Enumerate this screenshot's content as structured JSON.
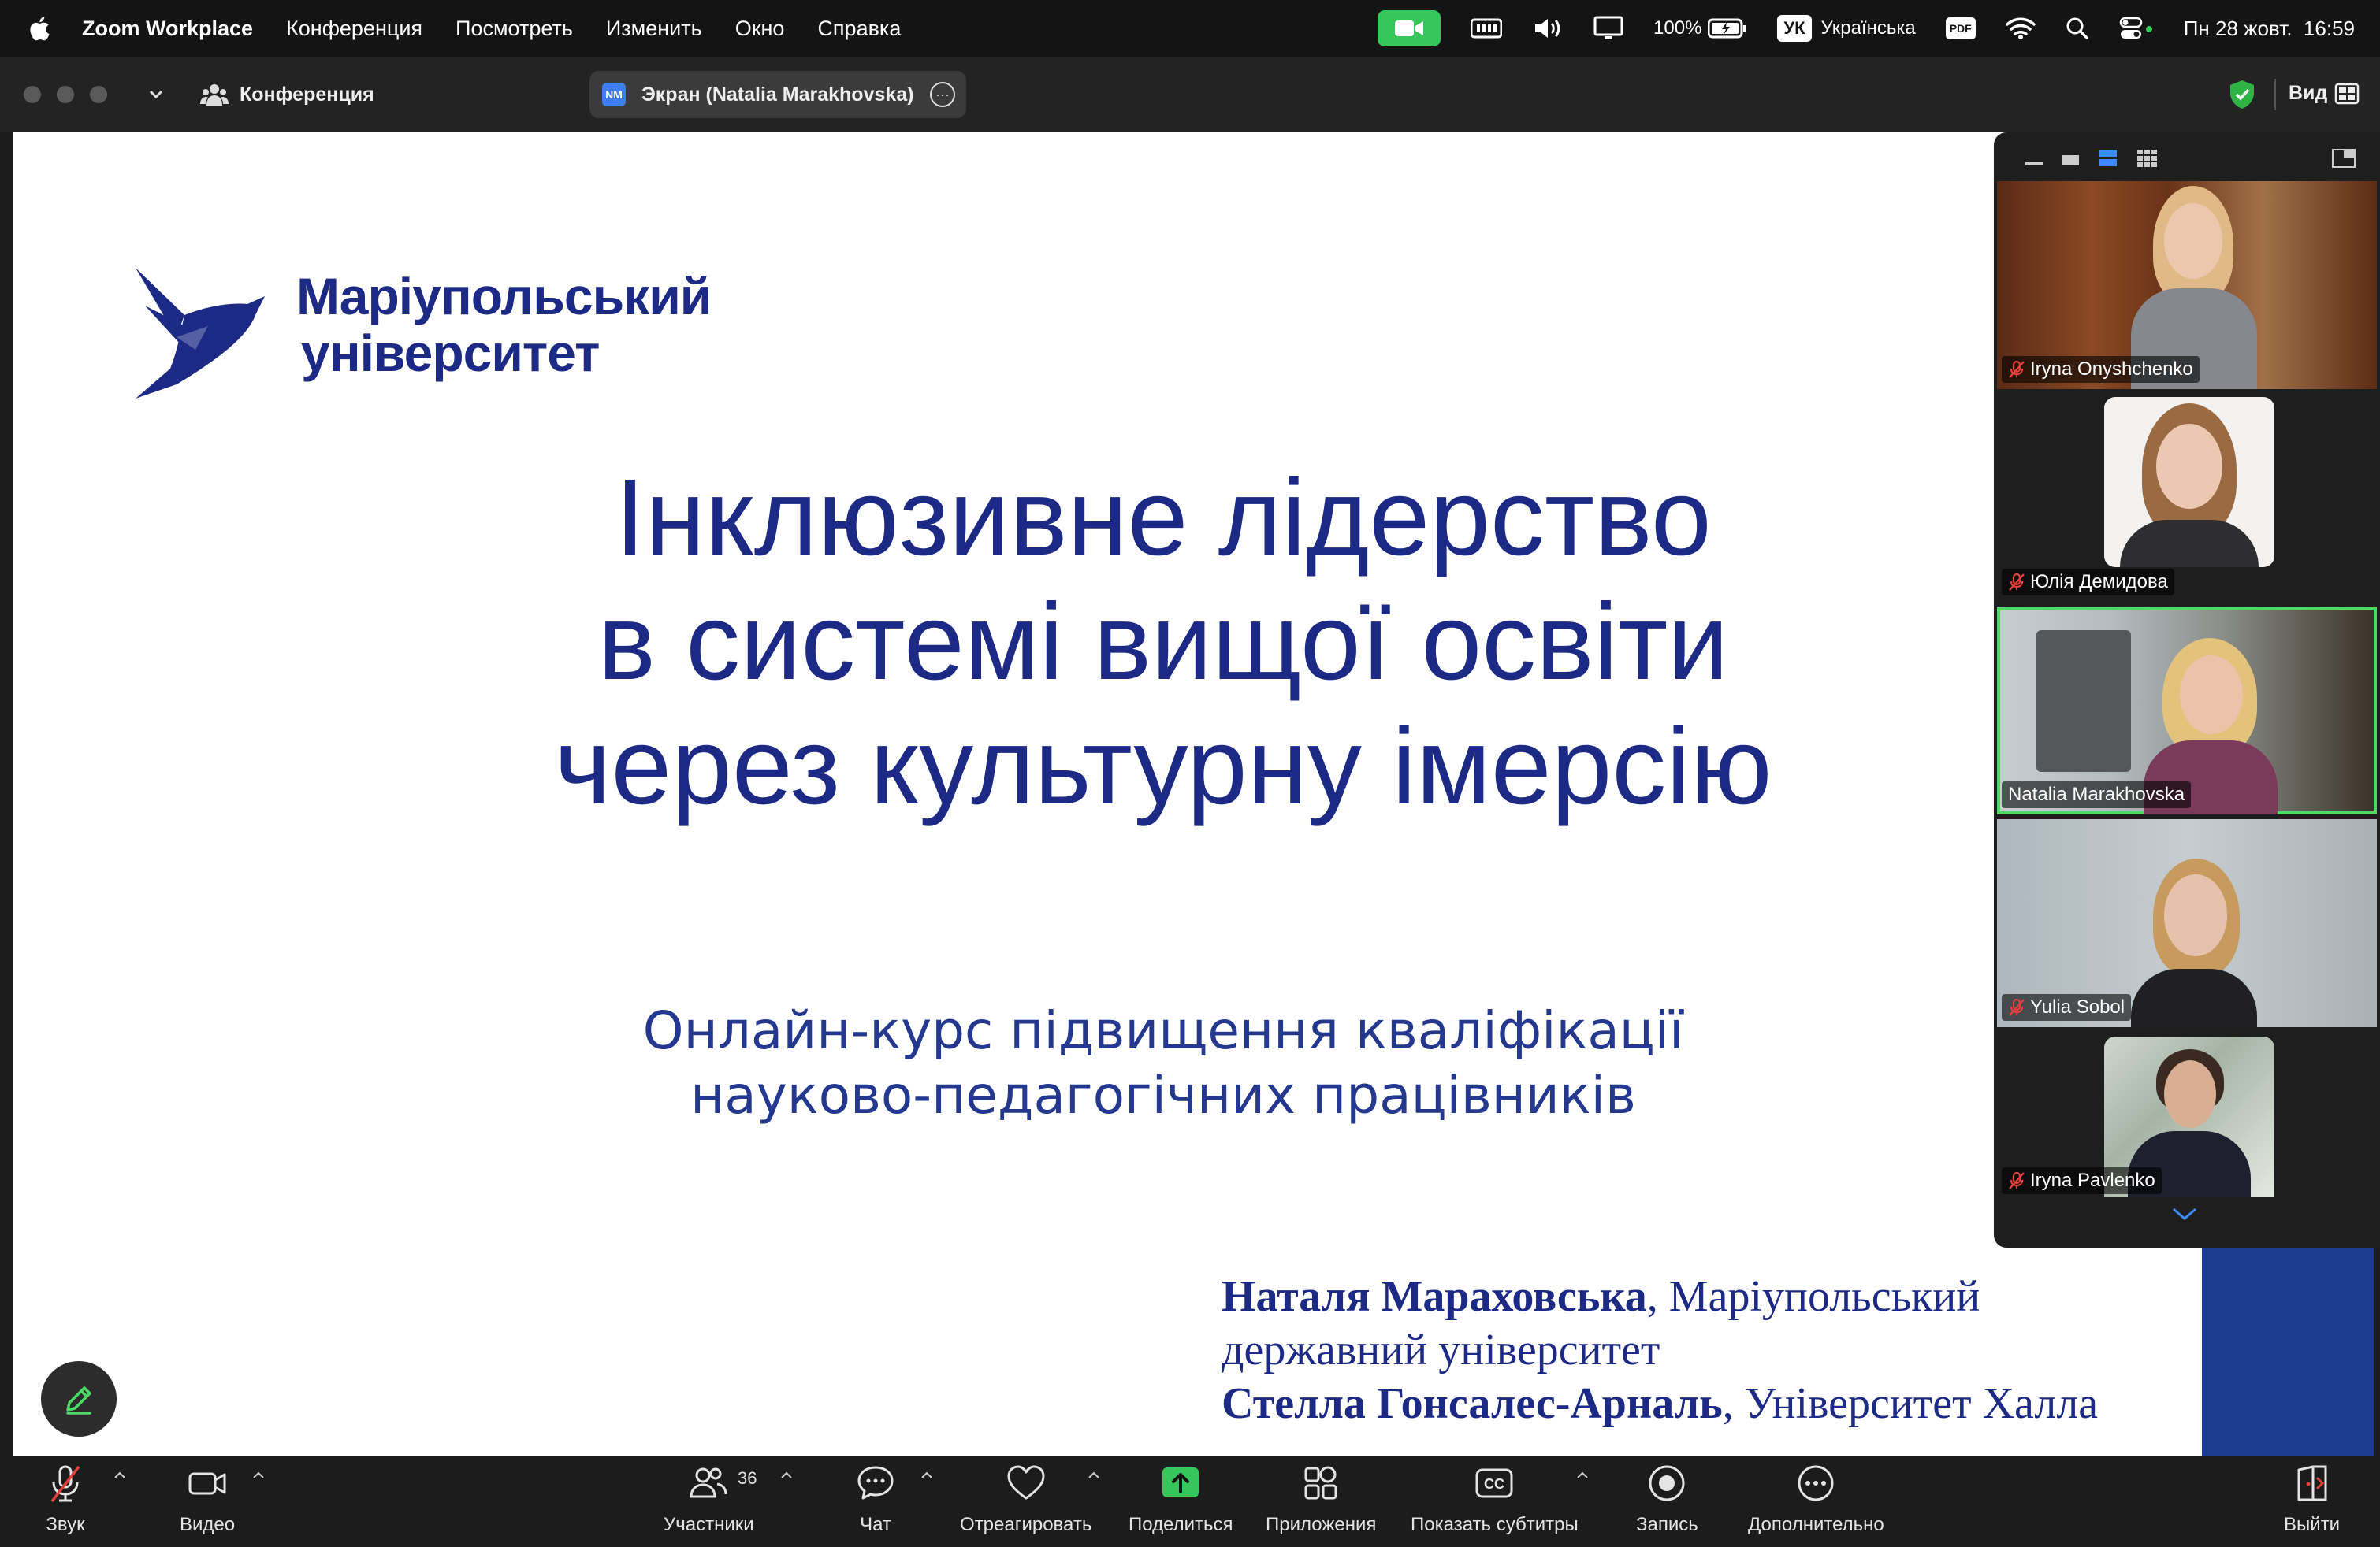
{
  "menubar": {
    "app_name": "Zoom Workplace",
    "items": [
      "Конференция",
      "Посмотреть",
      "Изменить",
      "Окно",
      "Справка"
    ],
    "battery": "100%",
    "input_lang_badge": "УК",
    "input_lang": "Українська",
    "pdf_badge": "PDF",
    "datetime": "Пн 28 жовт.  16:59"
  },
  "titlebar": {
    "conference_label": "Конференция",
    "share_badge": "NM",
    "share_label": "Экран (Natalia Marakhovska)",
    "view_label": "Вид"
  },
  "slide": {
    "logo_line1": "Маріупольський",
    "logo_line2": "університет",
    "title_lines": [
      "Інклюзивне лідерство",
      "в системі вищої освіти",
      "через культурну імерсію"
    ],
    "subtitle_lines": [
      "Онлайн-курс підвищення кваліфікації",
      "науково-педагогічних працівників"
    ],
    "author1_name": "Наталя Мараховська",
    "author1_affil_a": ", Маріупольський",
    "author1_affil_b": "державний університет",
    "author2_name": "Стелла Гонсалес-Арналь",
    "author2_affil": ", Університет Халла"
  },
  "participants": [
    {
      "name": "Iryna Onyshchenko",
      "muted": true
    },
    {
      "name": "Юлія Демидова",
      "muted": true
    },
    {
      "name": "Natalia Marakhovska",
      "muted": false
    },
    {
      "name": "Yulia Sobol",
      "muted": true
    },
    {
      "name": "Iryna Pavlenko",
      "muted": true
    }
  ],
  "toolbar": {
    "audio": "Звук",
    "video": "Видео",
    "participants": "Участники",
    "participants_count": "36",
    "chat": "Чат",
    "react": "Отреагировать",
    "share": "Поделиться",
    "apps": "Приложения",
    "captions": "Показать субтитры",
    "captions_icon_text": "CC",
    "record": "Запись",
    "more": "Дополнительно",
    "leave": "Выйти"
  },
  "colors": {
    "slide_blue": "#1d2a85",
    "active_speaker": "#4cd964",
    "share_green": "#35c759"
  }
}
